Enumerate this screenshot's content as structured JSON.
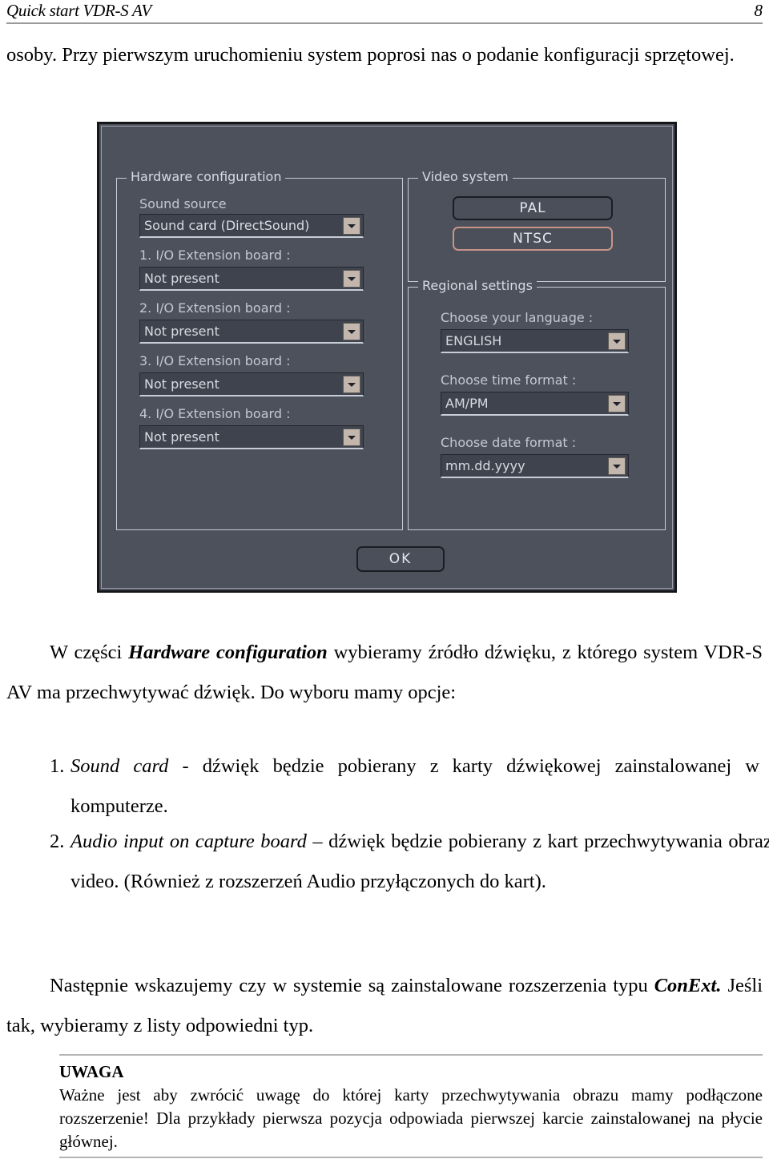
{
  "header": {
    "title": "Quick start VDR-S AV",
    "page_number": "8"
  },
  "body": {
    "para_intro": "osoby. Przy pierwszym uruchomieniu system poprosi nas o podanie konfiguracji sprzętowej.",
    "para_hardware_pre": "W części ",
    "para_hardware_em": "Hardware configuration",
    "para_hardware_post": " wybieramy źródło dźwięku, z którego system VDR-S AV ma przechwytywać dźwięk. Do wyboru mamy opcje:",
    "list": [
      {
        "marker": "1.",
        "em": "Sound card",
        "text": " - dźwięk będzie pobierany z karty dźwiękowej zainstalowanej w komputerze."
      },
      {
        "marker": "2.",
        "em": "Audio input on capture board",
        "text": " – dźwięk będzie pobierany z kart przechwytywania obrazu video. (Również z rozszerzeń Audio przyłączonych do kart)."
      }
    ],
    "para_conext_pre": "Następnie wskazujemy czy w systemie są zainstalowane rozszerzenia typu ",
    "para_conext_em": "ConExt.",
    "para_conext_post": " Jeśli tak, wybieramy z listy odpowiedni typ."
  },
  "note": {
    "title": "UWAGA",
    "text": "Ważne jest aby zwrócić uwagę do której karty przechwytywania obrazu mamy podłączone rozszerzenie! Dla przykłady pierwsza pozycja odpowiada pierwszej karcie zainstalowanej na płycie głównej."
  },
  "dialog": {
    "hardware_group": {
      "legend": "Hardware configuration",
      "sound_source_label": "Sound source",
      "sound_source_value": "Sound card (DirectSound)",
      "boards": [
        {
          "label": "1.  I/O Extension board :",
          "value": "Not present"
        },
        {
          "label": "2.  I/O Extension board :",
          "value": "Not present"
        },
        {
          "label": "3.  I/O Extension board :",
          "value": "Not present"
        },
        {
          "label": "4.  I/O Extension board :",
          "value": "Not present"
        }
      ]
    },
    "video_group": {
      "legend": "Video system",
      "pal_label": "PAL",
      "ntsc_label": "NTSC",
      "selected": "NTSC",
      "selected_border_color": "#c89488"
    },
    "regional_group": {
      "legend": "Regional settings",
      "language_label": "Choose your language :",
      "language_value": "ENGLISH",
      "time_format_label": "Choose time format :",
      "time_format_value": "AM/PM",
      "date_format_label": "Choose date format :",
      "date_format_value": "mm.dd.yyyy"
    },
    "ok_label": "OK",
    "panel_color": "#4d515c"
  }
}
